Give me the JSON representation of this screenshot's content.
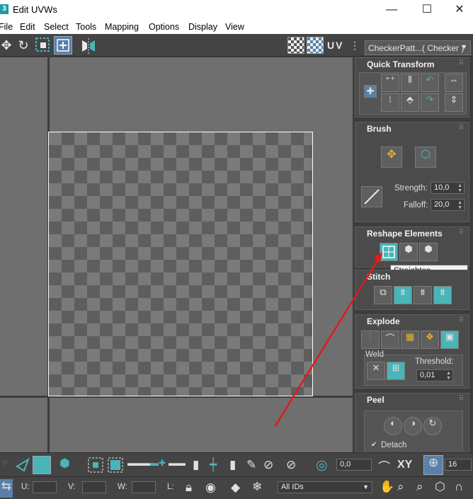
{
  "window": {
    "icon_letter": "3",
    "title": "Edit UVWs",
    "minimize": "—",
    "maximize": "☐",
    "close": "✕"
  },
  "menu": [
    "File",
    "Edit",
    "Select",
    "Tools",
    "Mapping",
    "Options",
    "Display",
    "View"
  ],
  "toolbar": {
    "uv_label": "UV",
    "texture_dropdown": "CheckerPatt...( Checker )"
  },
  "panels": {
    "quick_transform": {
      "title": "Quick Transform"
    },
    "brush": {
      "title": "Brush",
      "strength_label": "Strength:",
      "strength_value": "10,0",
      "falloff_label": "Falloff:",
      "falloff_value": "20,0"
    },
    "reshape": {
      "title": "Reshape Elements",
      "tooltip": "Straighten Selection"
    },
    "stitch": {
      "title": "Stitch"
    },
    "explode": {
      "title": "Explode",
      "weld_label": "Weld",
      "threshold_label": "Threshold:",
      "threshold_value": "0,01"
    },
    "peel": {
      "title": "Peel",
      "detach_label": "Detach"
    }
  },
  "bottom_bar": {
    "rotation_value": "0,0",
    "xy_label": "XY",
    "grid_value": "16",
    "u_label": "U:",
    "v_label": "V:",
    "w_label": "W:",
    "l_label": "L:",
    "ids_dropdown": "All IDs"
  },
  "colors": {
    "accent": "#4ab4b8",
    "arrow": "#e01b1b"
  }
}
